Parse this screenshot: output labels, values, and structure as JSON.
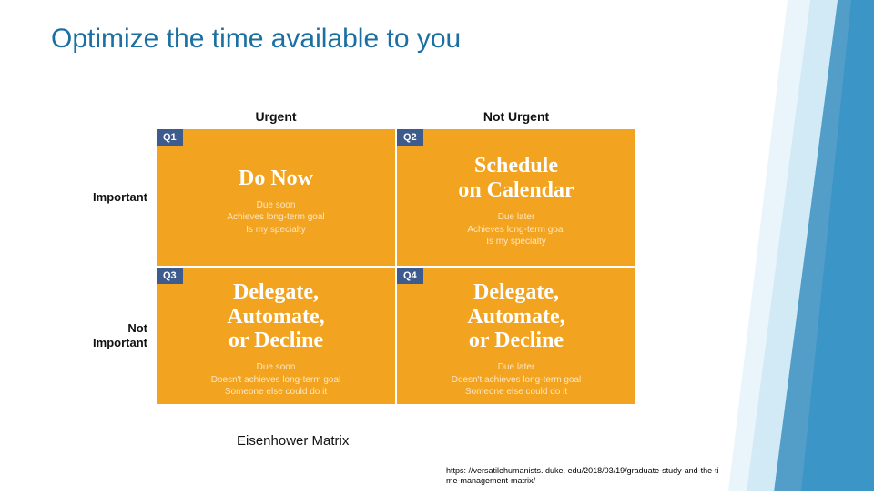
{
  "title": "Optimize the time available to you",
  "columns": {
    "c0": "Urgent",
    "c1": "Not Urgent"
  },
  "rows": {
    "r0": "Important",
    "r1": "Not\nImportant"
  },
  "quadrants": {
    "q1": {
      "badge": "Q1",
      "heading": "Do Now",
      "detail": "Due soon\nAchieves long-term goal\nIs my specialty"
    },
    "q2": {
      "badge": "Q2",
      "heading": "Schedule\non Calendar",
      "detail": "Due later\nAchieves long-term goal\nIs my specialty"
    },
    "q3": {
      "badge": "Q3",
      "heading": "Delegate,\nAutomate,\nor Decline",
      "detail": "Due soon\nDoesn't achieves long-term goal\nSomeone else could do it"
    },
    "q4": {
      "badge": "Q4",
      "heading": "Delegate,\nAutomate,\nor Decline",
      "detail": "Due later\nDoesn't achieves long-term goal\nSomeone else could do it"
    }
  },
  "caption": "Eisenhower Matrix",
  "source": "https: //versatilehumanists. duke. edu/2018/03/19/graduate-study-and-the-time-management-matrix/"
}
